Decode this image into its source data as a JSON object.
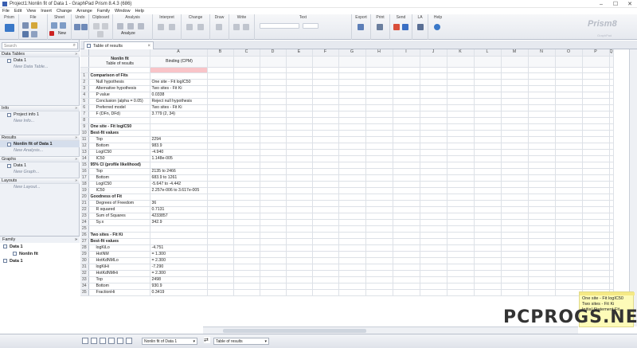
{
  "window": {
    "title": "Project1:Nonlin fit of Data 1 - GraphPad Prism 8.4.3 (686)"
  },
  "menu": [
    "File",
    "Edit",
    "View",
    "Insert",
    "Change",
    "Arrange",
    "Family",
    "Window",
    "Help"
  ],
  "ribbon_groups": [
    "Prism",
    "File",
    "Sheet",
    "Undo",
    "Clipboard",
    "Analysis",
    "Interpret",
    "Change",
    "Draw",
    "Write",
    "Text",
    "Export",
    "Print",
    "Send",
    "LA",
    "Help"
  ],
  "ribbon": {
    "analyze_label": "Analyze",
    "new_label": "New",
    "product": "Prism",
    "product_version": "8",
    "product_sub": "GraphPad"
  },
  "nav": {
    "search_placeholder": "Search",
    "sections": [
      {
        "title": "Data Tables",
        "items": [
          {
            "label": "Data 1"
          },
          {
            "label": "New Data Table...",
            "new": true
          }
        ]
      },
      {
        "title": "Info",
        "items": [
          {
            "label": "Project info 1"
          },
          {
            "label": "New Info...",
            "new": true
          }
        ]
      },
      {
        "title": "Results",
        "items": [
          {
            "label": "Nonlin fit of Data 1",
            "selected": true
          },
          {
            "label": "New Analysis...",
            "new": true
          }
        ]
      },
      {
        "title": "Graphs",
        "items": [
          {
            "label": "Data 1"
          },
          {
            "label": "New Graph...",
            "new": true
          }
        ]
      },
      {
        "title": "Layouts",
        "items": [
          {
            "label": "New Layout...",
            "new": true
          }
        ]
      }
    ]
  },
  "family": {
    "title": "Family",
    "items": [
      {
        "label": "Data 1",
        "level": 0
      },
      {
        "label": "Nonlin fit",
        "level": 1
      },
      {
        "label": "Data 1",
        "level": 0
      }
    ]
  },
  "sheet_tab": {
    "label": "Table of results"
  },
  "table": {
    "corner_title": "Nonlin fit",
    "corner_sub": "Table of results",
    "col_a_title": "Binding (CPM)",
    "columns": [
      "A",
      "B",
      "C",
      "D",
      "E",
      "F",
      "G",
      "H",
      "I",
      "J",
      "K",
      "L",
      "M",
      "N",
      "O",
      "P",
      "Q"
    ],
    "rows": [
      {
        "n": "1",
        "label": "Comparison of Fits",
        "value": "",
        "bold": true
      },
      {
        "n": "2",
        "label": "Null hypothesis",
        "value": "One site - Fit logIC50",
        "indent": true
      },
      {
        "n": "3",
        "label": "Alternative hypothesis",
        "value": "Two sites - Fit Ki",
        "indent": true
      },
      {
        "n": "4",
        "label": "P value",
        "value": "0.0338",
        "indent": true
      },
      {
        "n": "5",
        "label": "Conclusion (alpha = 0.05)",
        "value": "Reject null hypothesis",
        "indent": true
      },
      {
        "n": "6",
        "label": "Preferred model",
        "value": "Two sites - Fit Ki",
        "indent": true
      },
      {
        "n": "7",
        "label": "F (DFn, DFd)",
        "value": "3.779 (2, 34)",
        "indent": true
      },
      {
        "n": "8",
        "label": "",
        "value": ""
      },
      {
        "n": "9",
        "label": "One site - Fit logIC50",
        "value": "",
        "bold": true
      },
      {
        "n": "10",
        "label": "Best-fit values",
        "value": "",
        "bold": true
      },
      {
        "n": "11",
        "label": "Top",
        "value": "2294",
        "indent": true
      },
      {
        "n": "12",
        "label": "Bottom",
        "value": "983.9",
        "indent": true
      },
      {
        "n": "13",
        "label": "LogIC50",
        "value": "-4.940",
        "indent": true
      },
      {
        "n": "14",
        "label": "IC50",
        "value": "1.148e-005",
        "indent": true
      },
      {
        "n": "15",
        "label": "95% CI (profile likelihood)",
        "value": "",
        "bold": true
      },
      {
        "n": "16",
        "label": "Top",
        "value": "2135 to 2466",
        "indent": true
      },
      {
        "n": "17",
        "label": "Bottom",
        "value": "683.9 to 1261",
        "indent": true
      },
      {
        "n": "18",
        "label": "LogIC50",
        "value": "-5.647 to -4.442",
        "indent": true
      },
      {
        "n": "19",
        "label": "IC50",
        "value": "2.257e-006 to 3.617e-005",
        "indent": true
      },
      {
        "n": "20",
        "label": "Goodness of Fit",
        "value": "",
        "bold": true
      },
      {
        "n": "21",
        "label": "Degrees of Freedom",
        "value": "36",
        "indent": true
      },
      {
        "n": "22",
        "label": "R squared",
        "value": "0.7131",
        "indent": true
      },
      {
        "n": "23",
        "label": "Sum of Squares",
        "value": "4233857",
        "indent": true
      },
      {
        "n": "24",
        "label": "Sy.x",
        "value": "342.9",
        "indent": true
      },
      {
        "n": "25",
        "label": "",
        "value": ""
      },
      {
        "n": "26",
        "label": "Two sites - Fit Ki",
        "value": "",
        "bold": true
      },
      {
        "n": "27",
        "label": "Best-fit values",
        "value": "",
        "bold": true
      },
      {
        "n": "28",
        "label": "logKiLo",
        "value": "-4.751",
        "indent": true
      },
      {
        "n": "29",
        "label": "HotNM",
        "value": "= 1.300",
        "indent": true
      },
      {
        "n": "30",
        "label": "HotKdNMLo",
        "value": "= 2.300",
        "indent": true
      },
      {
        "n": "31",
        "label": "logKiHi",
        "value": "-7.290",
        "indent": true
      },
      {
        "n": "32",
        "label": "HotKdNMHi",
        "value": "= 2.300",
        "indent": true
      },
      {
        "n": "33",
        "label": "Top",
        "value": "2498",
        "indent": true
      },
      {
        "n": "34",
        "label": "Bottom",
        "value": "930.9",
        "indent": true
      },
      {
        "n": "35",
        "label": "FractionHi",
        "value": "0.3419",
        "indent": true
      }
    ]
  },
  "status": {
    "sheet_select": "Nonlin fit of Data 1",
    "view_select": "Table of results"
  },
  "sticky_note": {
    "lines": [
      "One site - Fit logIC50",
      "Two sites - Fit Ki",
      "Initial Statement Fit"
    ]
  },
  "watermark": "PCPROGS.NET",
  "colors": {
    "accent": "#3a78c8",
    "highlight": "#f8c4c8",
    "nav_bg": "#eef1f6"
  }
}
